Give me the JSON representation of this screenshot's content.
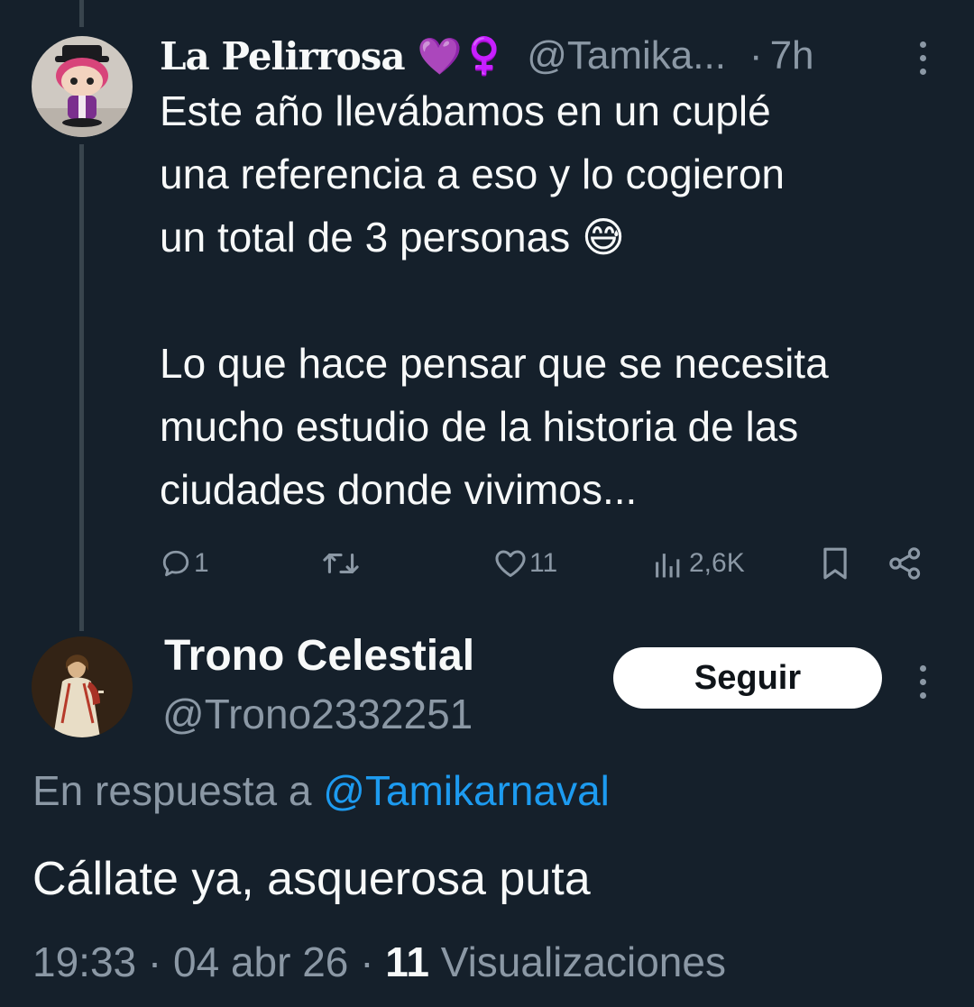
{
  "parent_tweet": {
    "display_name": "La Pelirrosa",
    "name_emojis": "💜♀️",
    "handle": "@Tamika...",
    "separator": "·",
    "time": "7h",
    "text_lines_1": [
      "Este año llevábamos en un cuplé",
      "una referencia a eso y lo cogieron",
      "un total de 3 personas 😅"
    ],
    "text_lines_2": [
      "Lo que hace pensar que se necesita",
      "mucho estudio de la historia de las",
      "ciudades donde vivimos..."
    ],
    "actions": {
      "replies": "1",
      "retweets": "",
      "likes": "11",
      "views": "2,6K"
    }
  },
  "reply_tweet": {
    "display_name": "Trono Celestial",
    "handle": "@Trono2332251",
    "follow_label": "Seguir",
    "in_reply_prefix": "En respuesta a",
    "in_reply_handle": "@Tamikarnaval",
    "text": "Cállate ya, asquerosa puta",
    "time": "19:33",
    "date": "04 abr 26",
    "views_count": "11",
    "views_label": "Visualizaciones"
  },
  "icons": {
    "reply": "reply-icon",
    "retweet": "retweet-icon",
    "like": "heart-icon",
    "views": "views-chart-icon",
    "bookmark": "bookmark-icon",
    "share": "share-icon",
    "more": "more-vertical-icon"
  },
  "colors": {
    "background": "#15202b",
    "text": "#f7f9f9",
    "secondary": "#8b98a5",
    "link": "#1d9bf0",
    "divider": "#38444d"
  }
}
